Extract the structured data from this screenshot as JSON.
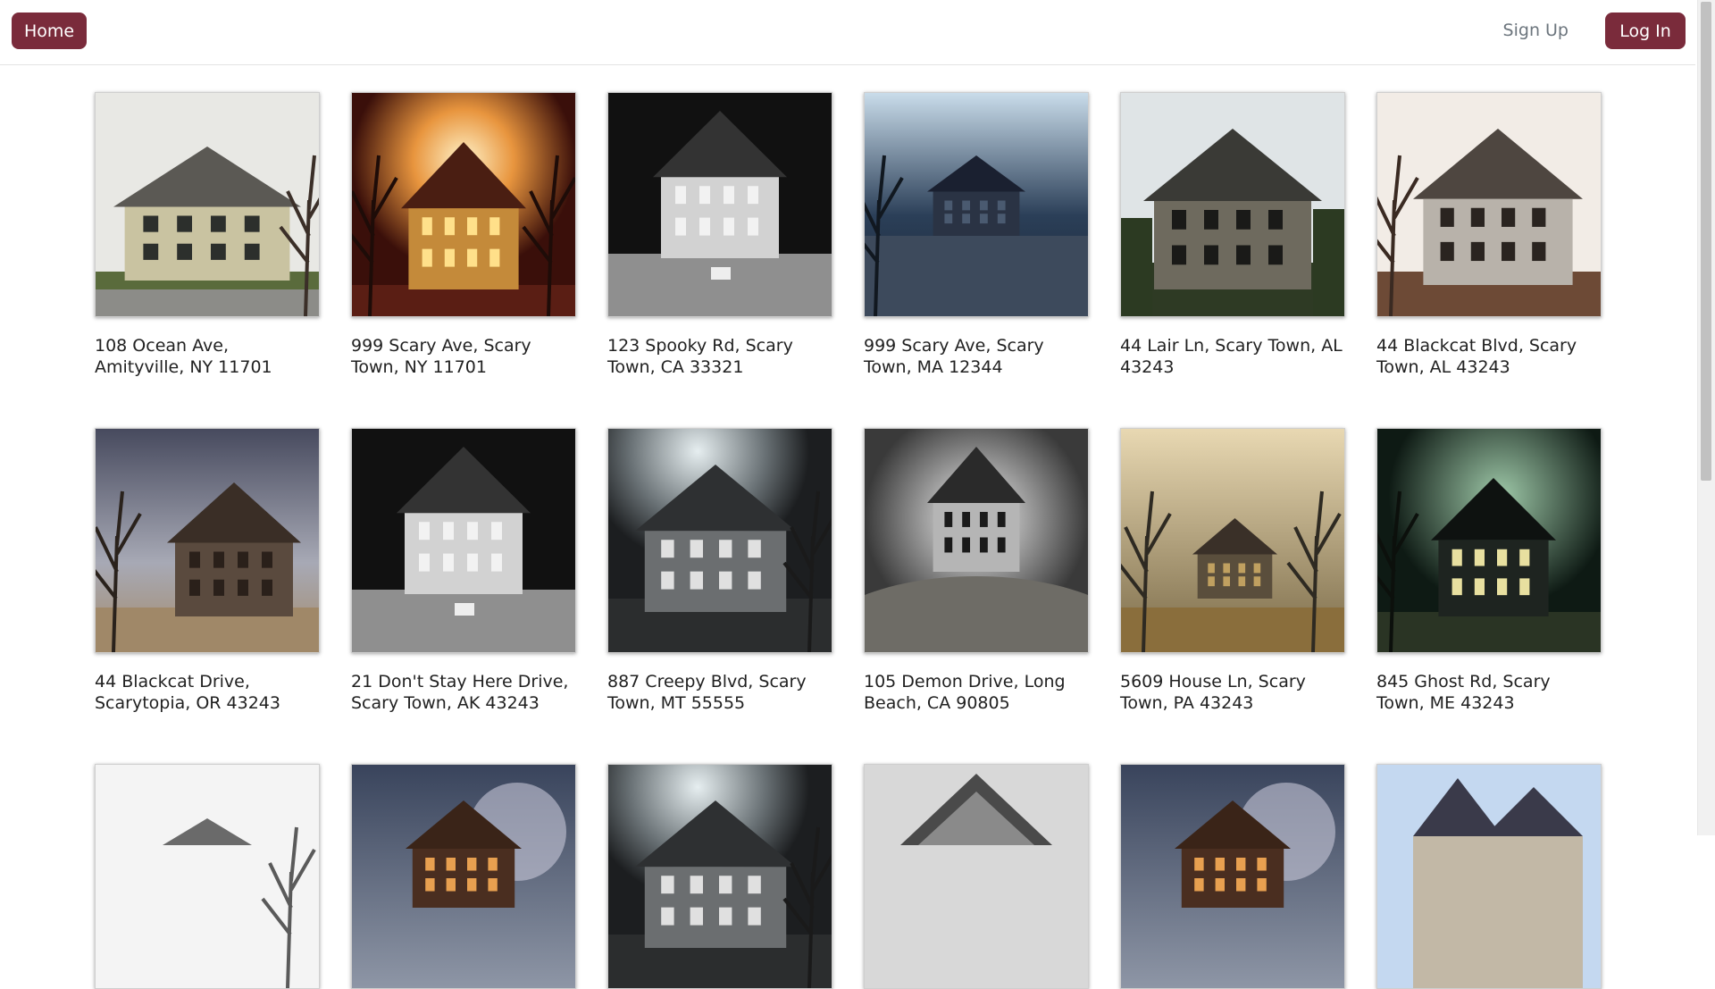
{
  "nav": {
    "home_label": "Home",
    "signup_label": "Sign Up",
    "login_label": "Log In",
    "brand_color": "#7a2b3b"
  },
  "listings": [
    {
      "address": "108 Ocean Ave, Amityville, NY 11701",
      "photo": "colonial-house-daylight"
    },
    {
      "address": "999 Scary Ave, Scary Town, NY 11701",
      "photo": "house-fiery-sky"
    },
    {
      "address": "123 Spooky Rd, Scary Town, CA 33321",
      "photo": "house-black-white-night"
    },
    {
      "address": "999 Scary Ave, Scary Town, MA 12344",
      "photo": "mansion-blue-night"
    },
    {
      "address": "44 Lair Ln, Scary Town, AL 43243",
      "photo": "ruined-mansion-overgrown"
    },
    {
      "address": "44 Blackcat Blvd, Scary Town, AL 43243",
      "photo": "abandoned-wooden-house"
    },
    {
      "address": "44 Blackcat Drive, Scarytopia, OR 43243",
      "photo": "abandoned-house-stormy-sky"
    },
    {
      "address": "21 Don't Stay Here Drive, Scary Town, AK 43243",
      "photo": "house-black-white-night"
    },
    {
      "address": "887 Creepy Blvd, Scary Town, MT 55555",
      "photo": "victorian-house-dark"
    },
    {
      "address": "105 Demon Drive, Long Beach, CA 90805",
      "photo": "lone-house-hill"
    },
    {
      "address": "5609 House Ln, Scary Town, PA 43243",
      "photo": "mansion-foggy-trees"
    },
    {
      "address": "845 Ghost Rd, Scary Town, ME 43243",
      "photo": "gothic-mansion-green-sky"
    },
    {
      "address": "",
      "photo": "house-misty-white"
    },
    {
      "address": "",
      "photo": "house-moon-night"
    },
    {
      "address": "",
      "photo": "victorian-house-dark"
    },
    {
      "address": "",
      "photo": "house-gable-grey"
    },
    {
      "address": "",
      "photo": "house-moon-night"
    },
    {
      "address": "",
      "photo": "house-blue-sky"
    }
  ]
}
